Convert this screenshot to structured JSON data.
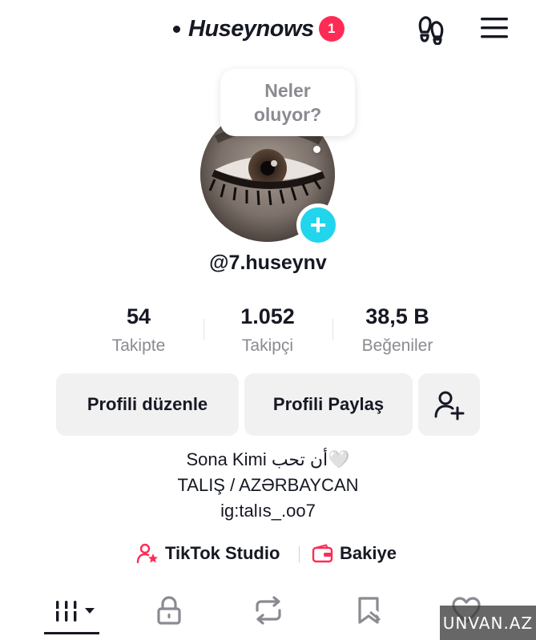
{
  "header": {
    "title": "Huseynows",
    "notification_count": "1",
    "icons": [
      "footprint-icon",
      "menu-icon"
    ]
  },
  "profile": {
    "bubble_text": "Neler oluyor?",
    "username": "@7.huseynv"
  },
  "stats": [
    {
      "value": "54",
      "label": "Takipte"
    },
    {
      "value": "1.052",
      "label": "Takipçi"
    },
    {
      "value": "38,5 B",
      "label": "Beğeniler"
    }
  ],
  "actions": {
    "edit_label": "Profili düzenle",
    "share_label": "Profili Paylaş"
  },
  "bio": {
    "line1_prefix": "Sona Kimi ",
    "line1_arabic": "أن تحب",
    "line1_heart": "🤍",
    "line2": "TALIŞ / AZƏRBAYCAN",
    "line3": "ig:talıs_.oo7"
  },
  "links": {
    "studio": "TikTok Studio",
    "balance": "Bakiye"
  },
  "tabs": [
    "videos-grid-icon",
    "lock-icon",
    "repost-icon",
    "saved-icon",
    "liked-icon"
  ],
  "watermark": "UNVAN.AZ",
  "colors": {
    "accent": "#fe2c55",
    "add_button": "#20d5ec",
    "secondary_text": "#8a8b91",
    "button_bg": "#f1f1f2"
  }
}
